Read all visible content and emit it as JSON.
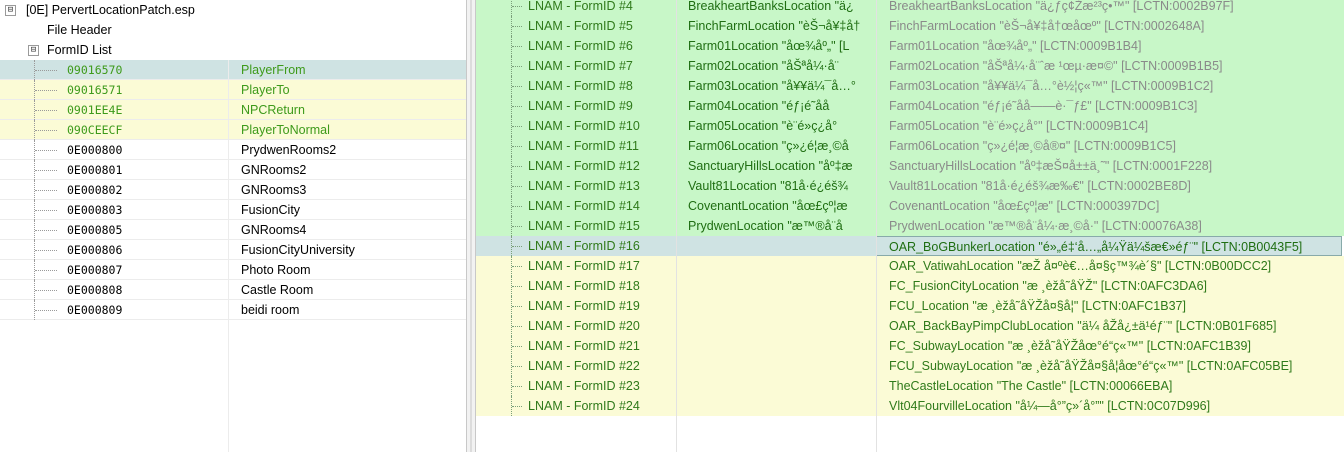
{
  "tree": {
    "root": {
      "toggle": "⊟",
      "label": "[0E] PervertLocationPatch.esp"
    },
    "file_header": "File Header",
    "formid_list": {
      "toggle": "⊟",
      "label": "FormID List"
    },
    "rows": [
      {
        "id": "09016570",
        "edid": "PlayerFrom",
        "style": "sel"
      },
      {
        "id": "09016571",
        "edid": "PlayerTo",
        "style": "yellow"
      },
      {
        "id": "0901EE4E",
        "edid": "NPCReturn",
        "style": "yellow"
      },
      {
        "id": "090CEECF",
        "edid": "PlayerToNormal",
        "style": "yellow"
      },
      {
        "id": "0E000800",
        "edid": "PrydwenRooms2",
        "style": "plain"
      },
      {
        "id": "0E000801",
        "edid": "GNRooms2",
        "style": "plain"
      },
      {
        "id": "0E000802",
        "edid": "GNRooms3",
        "style": "plain"
      },
      {
        "id": "0E000803",
        "edid": "FusionCity",
        "style": "plain"
      },
      {
        "id": "0E000805",
        "edid": "GNRooms4",
        "style": "plain"
      },
      {
        "id": "0E000806",
        "edid": "FusionCityUniversity",
        "style": "plain"
      },
      {
        "id": "0E000807",
        "edid": "Photo Room",
        "style": "plain"
      },
      {
        "id": "0E000808",
        "edid": "Castle Room",
        "style": "plain"
      },
      {
        "id": "0E000809",
        "edid": "beidi room",
        "style": "plain"
      }
    ]
  },
  "grid": {
    "rows": [
      {
        "label": "LNAM - FormID #4",
        "base": "BreakheartBanksLocation \"ä¿",
        "override": "BreakheartBanksLocation \"ä¿ƒç¢Žæ²³ç•™\" [LCTN:0002B97F]",
        "style": "green"
      },
      {
        "label": "LNAM - FormID #5",
        "base": "FinchFarmLocation \"èŠ¬å¥‡å†",
        "override": "FinchFarmLocation \"èŠ¬å¥‡å†œåœº\" [LCTN:0002648A]",
        "style": "green"
      },
      {
        "label": "LNAM - FormID #6",
        "base": "Farm01Location \"åœ¾åº„\" [L",
        "override": "Farm01Location \"åœ¾åº„\" [LCTN:0009B1B4]",
        "style": "green"
      },
      {
        "label": "LNAM - FormID #7",
        "base": "Farm02Location \"åŠªå¼·å¨",
        "override": "Farm02Location \"åŠªå¼·å¨ˆæ ¹œµ·æ¤©\" [LCTN:0009B1B5]",
        "style": "green"
      },
      {
        "label": "LNAM - FormID #8",
        "base": "Farm03Location \"å¥¥ä¼¯å…°",
        "override": "Farm03Location \"å¥¥ä¼¯å…°è½¦ç«™\" [LCTN:0009B1C2]",
        "style": "green"
      },
      {
        "label": "LNAM - FormID #9",
        "base": "Farm04Location \"éƒ¡é˜åå",
        "override": "Farm04Location \"éƒ¡é˜åå——è·¯ƒ£\" [LCTN:0009B1C3]",
        "style": "green"
      },
      {
        "label": "LNAM - FormID #10",
        "base": "Farm05Location \"è¨é»ç¿å°",
        "override": "Farm05Location \"è¨é»ç¿å°\" [LCTN:0009B1C4]",
        "style": "green"
      },
      {
        "label": "LNAM - FormID #11",
        "base": "Farm06Location \"ç»¿é¦æ¸©å",
        "override": "Farm06Location \"ç»¿é¦æ¸©å®¤\" [LCTN:0009B1C5]",
        "style": "green"
      },
      {
        "label": "LNAM - FormID #12",
        "base": "SanctuaryHillsLocation \"åº‡æ",
        "override": "SanctuaryHillsLocation \"åº‡æŠ¤å±±ä¸˜\" [LCTN:0001F228]",
        "style": "green"
      },
      {
        "label": "LNAM - FormID #13",
        "base": "Vault81Location \"81å·é¿éš¾",
        "override": "Vault81Location \"81å·é¿éš¾æ‰€\" [LCTN:0002BE8D]",
        "style": "green"
      },
      {
        "label": "LNAM - FormID #14",
        "base": "CovenantLocation \"åœ£çº¦æ",
        "override": "CovenantLocation \"åœ£çº¦æ\" [LCTN:000397DC]",
        "style": "green"
      },
      {
        "label": "LNAM - FormID #15",
        "base": "PrydwenLocation \"æ™®å¨å",
        "override": "PrydwenLocation \"æ™®å¨å¼·æ¸©å·\" [LCTN:00076A38]",
        "style": "green"
      },
      {
        "label": "LNAM - FormID #16",
        "base": "",
        "override": "OAR_BoGBunkerLocation \"é»„é‡‘å…„å¼Ÿä¼šæ€»éƒ¨\" [LCTN:0B0043F5]",
        "style": "sel"
      },
      {
        "label": "LNAM - FormID #17",
        "base": "",
        "override": "OAR_VatiwahLocation \"æŽ å¤ºè€…å¤§ç™¾è´§\" [LCTN:0B00DCC2]",
        "style": "yellow"
      },
      {
        "label": "LNAM - FormID #18",
        "base": "",
        "override": "FC_FusionCityLocation \"æ ¸èžå˜åŸŽ\" [LCTN:0AFC3DA6]",
        "style": "yellow"
      },
      {
        "label": "LNAM - FormID #19",
        "base": "",
        "override": "FCU_Location \"æ ¸èžå˜åŸŽå¤§å­¦\" [LCTN:0AFC1B37]",
        "style": "yellow"
      },
      {
        "label": "LNAM - FormID #20",
        "base": "",
        "override": "OAR_BackBayPimpClubLocation \"ä¼ åŽå¿±ä¹éƒ¨\" [LCTN:0B01F685]",
        "style": "yellow"
      },
      {
        "label": "LNAM - FormID #21",
        "base": "",
        "override": "FC_SubwayLocation \"æ ¸èžå˜åŸŽåœ°é“ç«™\" [LCTN:0AFC1B39]",
        "style": "yellow"
      },
      {
        "label": "LNAM - FormID #22",
        "base": "",
        "override": "FCU_SubwayLocation \"æ ¸èžå˜åŸŽå¤§å­¦åœ°é“ç«™\" [LCTN:0AFC05BE]",
        "style": "yellow"
      },
      {
        "label": "LNAM - FormID #23",
        "base": "",
        "override": "TheCastleLocation \"The Castle\" [LCTN:00066EBA]",
        "style": "yellow"
      },
      {
        "label": "LNAM - FormID #24",
        "base": "",
        "override": "Vlt04FourvilleLocation \"å¼—å°”ç»´å°”\" [LCTN:0C07D996]",
        "style": "yellow"
      }
    ]
  }
}
